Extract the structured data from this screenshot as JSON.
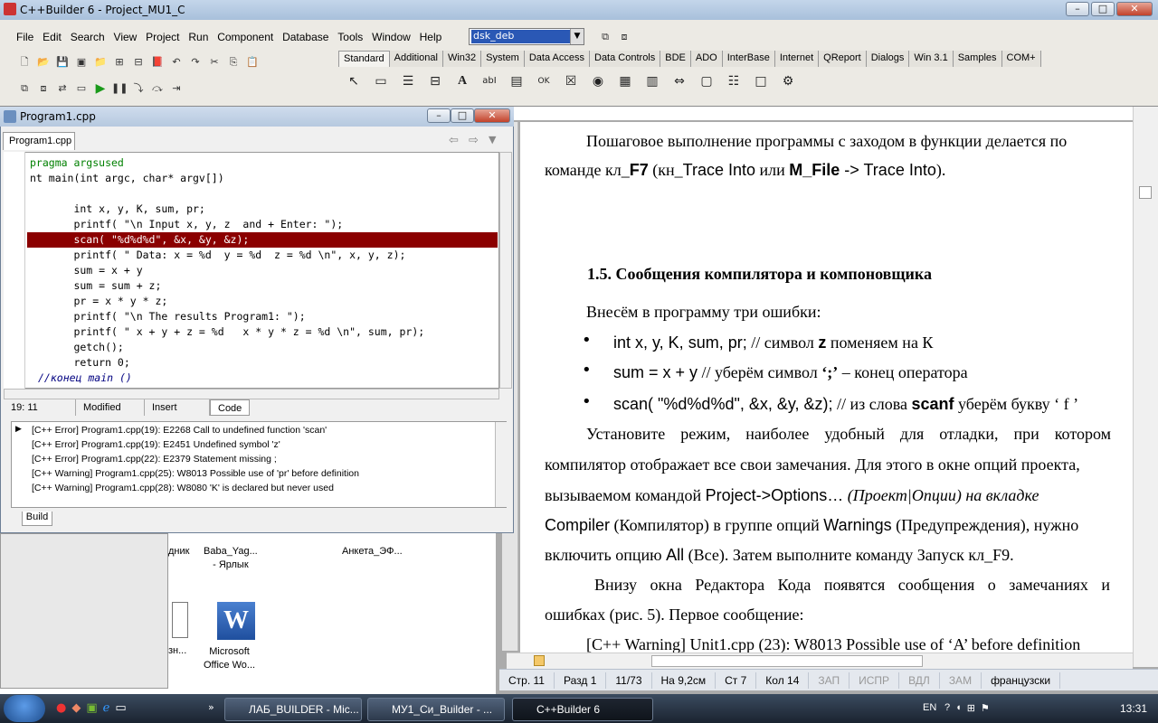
{
  "ide": {
    "title": "C++Builder 6 - Project_MU1_C",
    "menu": [
      "File",
      "Edit",
      "Search",
      "View",
      "Project",
      "Run",
      "Component",
      "Database",
      "Tools",
      "Window",
      "Help"
    ],
    "config": "dsk_deb",
    "palette_tabs": [
      "Standard",
      "Additional",
      "Win32",
      "System",
      "Data Access",
      "Data Controls",
      "BDE",
      "ADO",
      "InterBase",
      "Internet",
      "QReport",
      "Dialogs",
      "Win 3.1",
      "Samples",
      "COM+"
    ]
  },
  "editor": {
    "title": "Program1.cpp",
    "tab": "Program1.cpp",
    "lines": [
      "pragma argsused",
      "nt main(int argc, char* argv[])",
      "",
      "       int x, y, K, sum, pr;",
      "       printf( \"\\n Input x, y, z  and + Enter: \");",
      "       scan( \"%d%d%d\", &x, &y, &z);",
      "       printf( \" Data: x = %d  y = %d  z = %d \\n\", x, y, z);",
      "       sum = x + y",
      "       sum = sum + z;",
      "       pr = x * y * z;",
      "       printf( \"\\n The results Program1: \");",
      "       printf( \" x + y + z = %d   x * y * z = %d \\n\", sum, pr);",
      "       getch();",
      "       return 0;",
      "//конец main ()"
    ],
    "status": {
      "pos": "19: 11",
      "modified": "Modified",
      "mode": "Insert",
      "view": "Code"
    },
    "messages": [
      "[C++ Error] Program1.cpp(19): E2268 Call to undefined function 'scan'",
      "[C++ Error] Program1.cpp(19): E2451 Undefined symbol 'z'",
      "[C++ Error] Program1.cpp(22): E2379 Statement missing ;",
      "[C++ Warning] Program1.cpp(25): W8013 Possible use of 'pr' before definition",
      "[C++ Warning] Program1.cpp(28): W8080 'K' is declared but never used"
    ],
    "build_tab": "Build"
  },
  "desktop": {
    "icon1": "Baba_Yag...\n- Ярлык",
    "icon2": "Анкета_ЭФ...",
    "icon3": "Microsoft\nOffice Wo...",
    "partial1": "дник",
    "partial2": "зн..."
  },
  "word": {
    "p1a": "Пошаговое выполнение программы с заходом в функции делается по",
    "p1b_1": "команде кл_",
    "p1b_f7": "F7",
    "p1b_2": " (кн_",
    "p1b_ti": "Trace Into",
    "p1b_3": " или ",
    "p1b_mfile": "M_File",
    "p1b_4": " -> ",
    "p1b_ti2": "Trace Into",
    "p1b_5": ").",
    "heading": "1.5. Сообщения компилятора и компоновщика",
    "intro": "Внесём в программу три ошибки:",
    "b1_code": "int x, y, K, sum, pr;",
    "b1_text": "   // символ ",
    "b1_z": "z",
    "b1_text2": " поменяем на К",
    "b2_code": "sum = x + y",
    "b2_text": "   // уберём символ ",
    "b2_semi": "‘;’",
    "b2_text2": " – конец оператора",
    "b3_code": "scan( \"%d%d%d\", &x, &y, &z);",
    "b3_text": " // из слова ",
    "b3_scanf": "scanf",
    "b3_text2": " уберём букву ‘ f ’",
    "p2a": "Установите режим, наиболее удобный для отладки, при котором",
    "p2b": "компилятор отображает все свои замечания.  Для этого в окне опций проекта,",
    "p2c_1": "вызываемом командой ",
    "p2c_po": "Project->Options…",
    "p2c_2": " (Проект|Опции) на вкладке",
    "p2d_comp": "Compiler",
    "p2d_1": " (Компилятор) в группе опций ",
    "p2d_warn": "Warnings",
    "p2d_2": " (Предупреждения), нужно",
    "p2e_1": "включить опцию ",
    "p2e_all": "All",
    "p2e_2": " (Все). Затем выполните команду Запуск кл_F9.",
    "p3a": "Внизу окна Редактора Кода появятся сообщения о замечаниях и",
    "p3b": "ошибках (рис. 5). Первое сообщение:",
    "p3c": "[C++ Warning] Unit1.cpp (23): W8013 Possible use of ‘A’ before definition",
    "status": [
      "Стр. 11",
      "Разд 1",
      "11/73",
      "На 9,2см",
      "Ст 7",
      "Кол 14",
      "ЗАП",
      "ИСПР",
      "ВДЛ",
      "ЗАМ",
      "французски"
    ]
  },
  "taskbar": {
    "tasks": [
      "ЛАБ_BUILDER - Mic...",
      "МУ1_Си_Builder - ...",
      "C++Builder 6"
    ],
    "lang": "EN",
    "time": "13:31"
  }
}
